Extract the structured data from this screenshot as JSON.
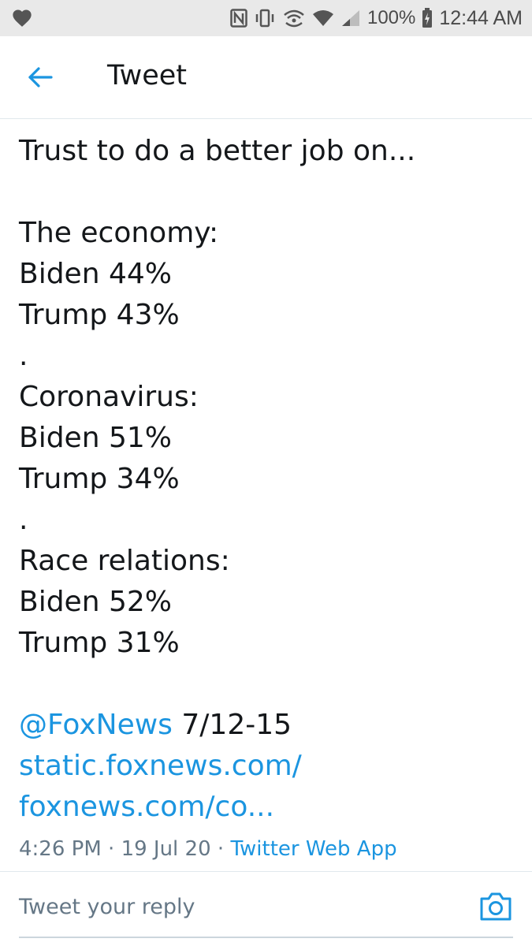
{
  "status_bar": {
    "battery_percent": "100%",
    "time": "12:44 AM",
    "icons": [
      "heart-icon",
      "nfc-icon",
      "vibrate-icon",
      "hotspot-icon",
      "wifi-icon",
      "signal-icon",
      "battery-charging-icon"
    ]
  },
  "header": {
    "title": "Tweet",
    "back_icon": "arrow-left-icon"
  },
  "tweet": {
    "lines": [
      "Trust to do a better job on...",
      "",
      "The economy:",
      "Biden 44%",
      "Trump 43%",
      ".",
      "Coronavirus:",
      "Biden 51%",
      "Trump 34%",
      ".",
      "Race relations:",
      "Biden 52%",
      "Trump 31%",
      ""
    ],
    "mention": "@FoxNews",
    "date_range": " 7/12-15",
    "link_line_1": "static.foxnews.com/",
    "link_line_2": "foxnews.com/co...",
    "time": "4:26 PM",
    "separator": " · ",
    "date": "19 Jul 20",
    "source": "Twitter Web App"
  },
  "reply": {
    "placeholder": "Tweet your reply",
    "camera_icon": "camera-icon"
  },
  "colors": {
    "link": "#1b95e0",
    "text": "#14171a",
    "muted": "#657786",
    "status_bar_bg": "#e9e9e9"
  }
}
